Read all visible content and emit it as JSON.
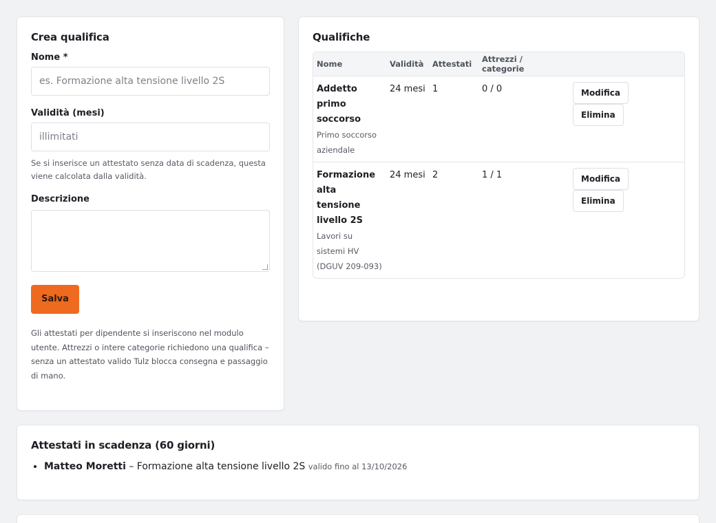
{
  "crea": {
    "title": "Crea qualifica",
    "nome_label": "Nome *",
    "nome_placeholder": "es. Formazione alta tensione livello 2S",
    "validita_label": "Validità (mesi)",
    "validita_placeholder": "illimitati",
    "validita_hint": "Se si inserisce un attestato senza data di scadenza, questa viene calcolata dalla validità.",
    "descrizione_label": "Descrizione",
    "save_label": "Salva",
    "footnote": "Gli attestati per dipendente si inseriscono nel modulo utente. Attrezzi o intere categorie richiedono una qualifica – senza un attestato valido Tulz blocca consegna e passaggio di mano."
  },
  "qualifiche": {
    "title": "Qualifiche",
    "headers": [
      "Nome",
      "Validità",
      "Attestati",
      "Attrezzi / categorie",
      ""
    ],
    "rows": [
      {
        "name": "Addetto primo soccorso",
        "desc": "Primo soccorso aziendale",
        "validita": "24 mesi",
        "attestati": "1",
        "attrezzi": "0 / 0",
        "edit": "Modifica",
        "delete": "Elimina"
      },
      {
        "name": "Formazione alta tensione livello 2S",
        "desc": "Lavori su sistemi HV (DGUV 209-093)",
        "validita": "24 mesi",
        "attestati": "2",
        "attrezzi": "1 / 1",
        "edit": "Modifica",
        "delete": "Elimina"
      }
    ]
  },
  "scadenza": {
    "title": "Attestati in scadenza (60 giorni)",
    "items": [
      {
        "person": "Matteo Moretti",
        "qualifica": " – Formazione alta tensione livello 2S ",
        "valid_until": "valido fino al 13/10/2026"
      }
    ]
  },
  "colors": {
    "accent": "#ee6a1f",
    "background": "#f1f2f4"
  }
}
